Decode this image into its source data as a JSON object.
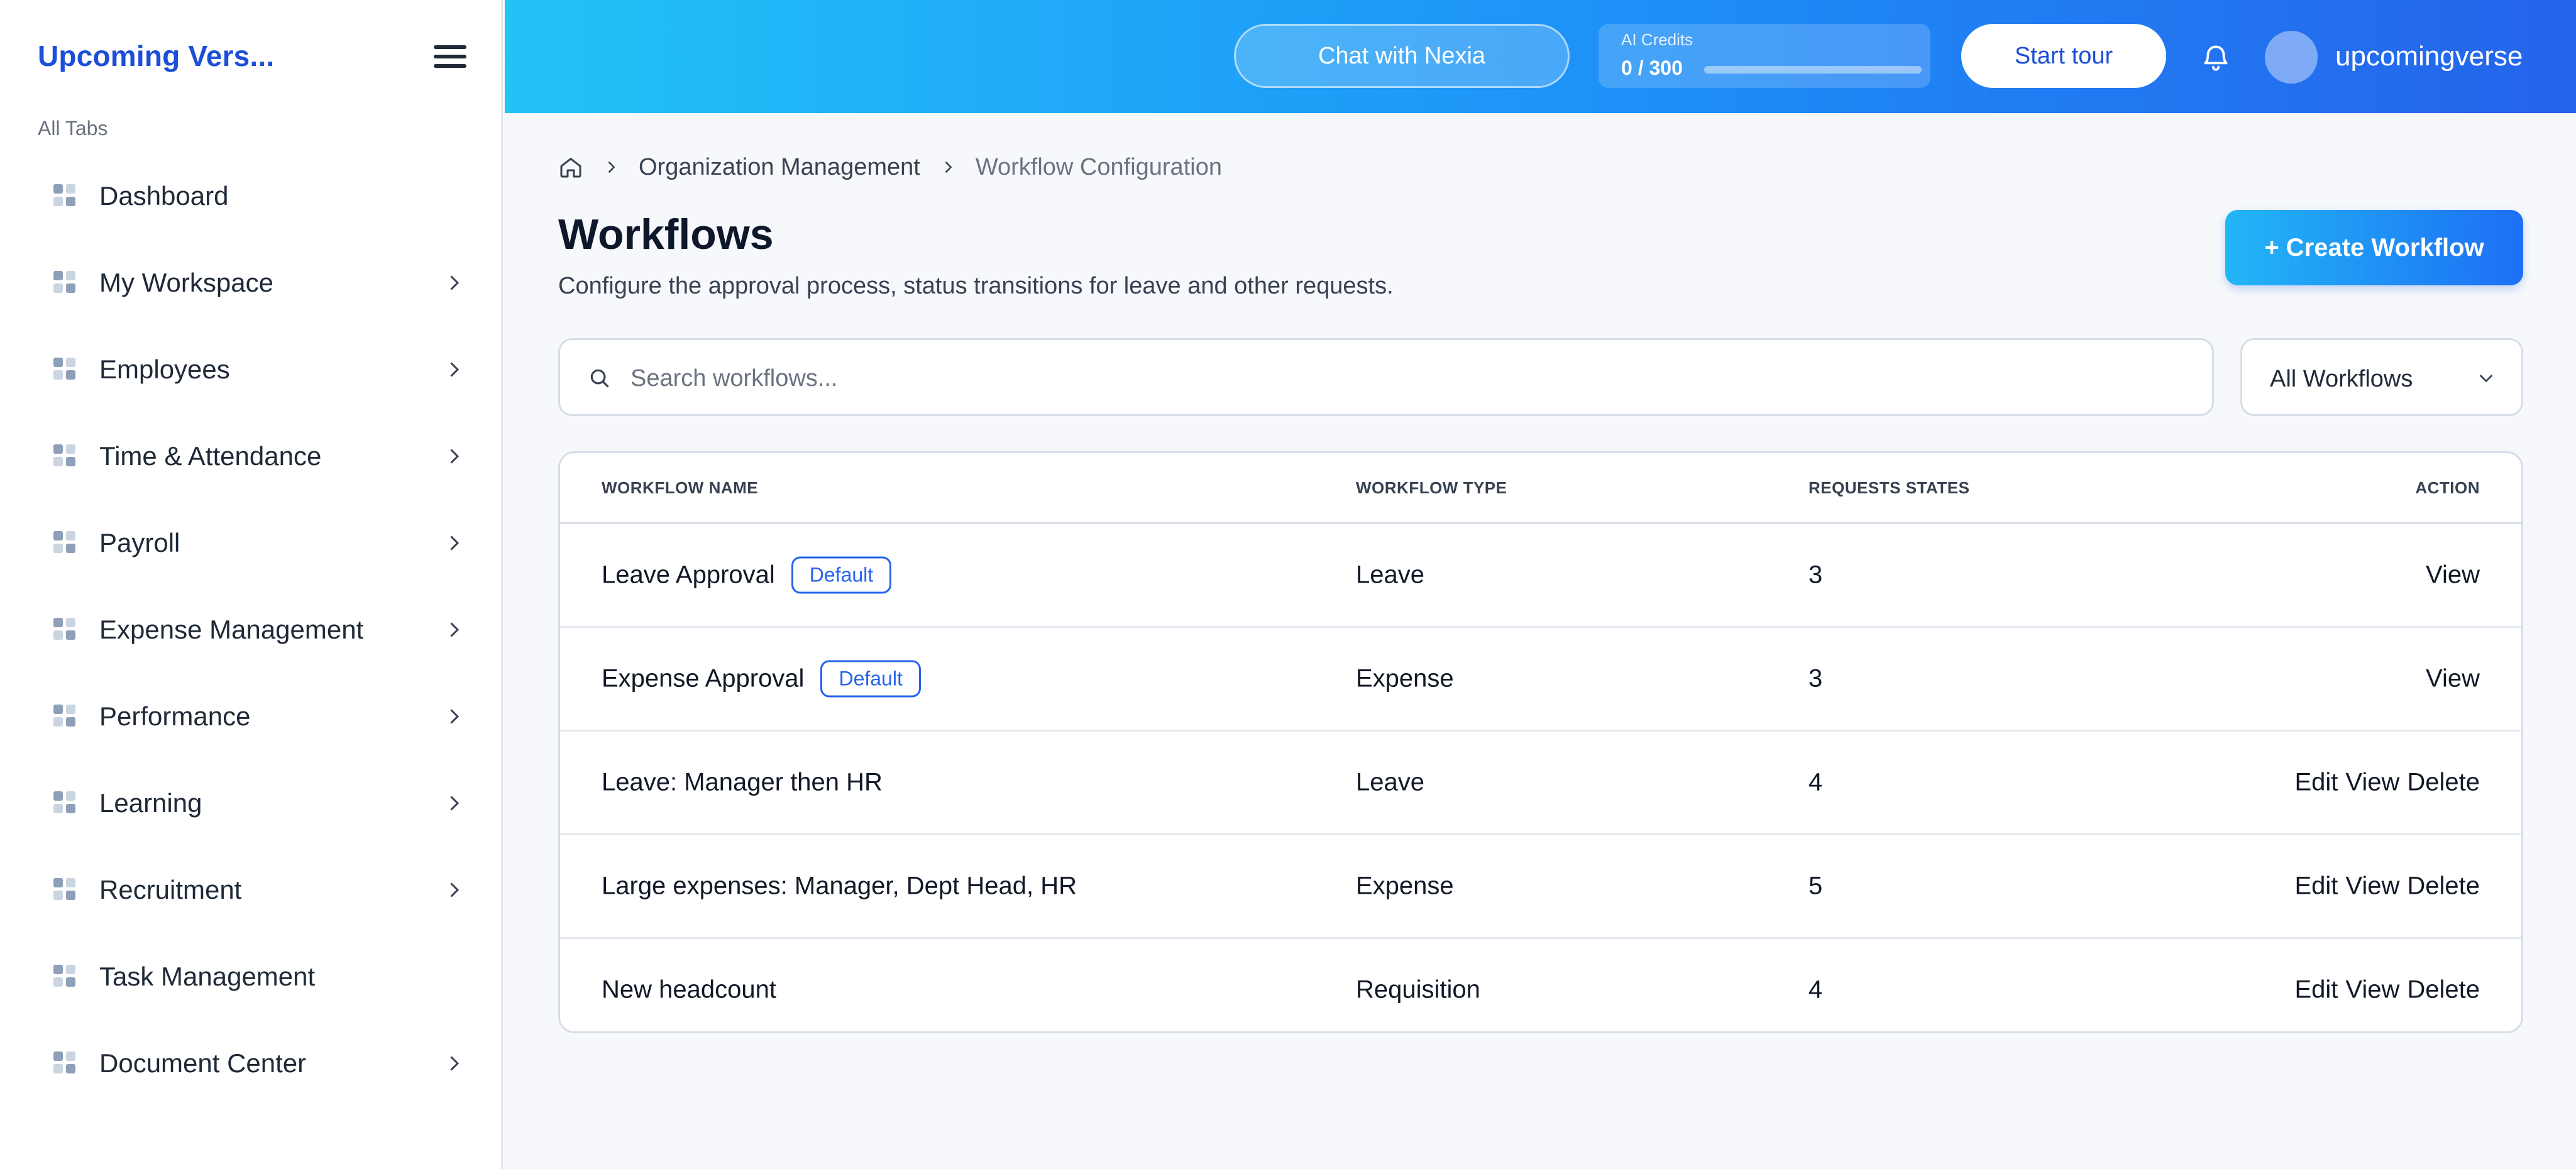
{
  "sidebar": {
    "brand": "Upcoming Vers...",
    "section_label": "All Tabs",
    "items": [
      {
        "label": "Dashboard",
        "has_chevron": false
      },
      {
        "label": "My Workspace",
        "has_chevron": true
      },
      {
        "label": "Employees",
        "has_chevron": true
      },
      {
        "label": "Time & Attendance",
        "has_chevron": true
      },
      {
        "label": "Payroll",
        "has_chevron": true
      },
      {
        "label": "Expense Management",
        "has_chevron": true
      },
      {
        "label": "Performance",
        "has_chevron": true
      },
      {
        "label": "Learning",
        "has_chevron": true
      },
      {
        "label": "Recruitment",
        "has_chevron": true
      },
      {
        "label": "Task Management",
        "has_chevron": false
      },
      {
        "label": "Document Center",
        "has_chevron": true
      }
    ]
  },
  "header": {
    "chat_label": "Chat with Nexia",
    "credits_label": "AI Credits",
    "credits_value": "0 / 300",
    "credits_progress": 0,
    "tour_label": "Start tour",
    "username": "upcomingverse"
  },
  "breadcrumb": {
    "items": [
      "Organization Management",
      "Workflow Configuration"
    ]
  },
  "page": {
    "title": "Workflows",
    "subtitle": "Configure the approval process, status transitions for leave and other requests.",
    "create_label": "+ Create Workflow"
  },
  "search": {
    "placeholder": "Search workflows...",
    "value": ""
  },
  "filter": {
    "selected": "All Workflows"
  },
  "table": {
    "columns": [
      "WORKFLOW NAME",
      "WORKFLOW TYPE",
      "REQUESTS STATES",
      "ACTION"
    ],
    "rows": [
      {
        "name": "Leave Approval",
        "badge": "Default",
        "type": "Leave",
        "states": "3",
        "actions": [
          "View"
        ]
      },
      {
        "name": "Expense Approval",
        "badge": "Default",
        "type": "Expense",
        "states": "3",
        "actions": [
          "View"
        ]
      },
      {
        "name": "Leave: Manager then HR",
        "badge": "",
        "type": "Leave",
        "states": "4",
        "actions": [
          "Edit",
          "View",
          "Delete"
        ]
      },
      {
        "name": "Large expenses: Manager, Dept Head, HR",
        "badge": "",
        "type": "Expense",
        "states": "5",
        "actions": [
          "Edit",
          "View",
          "Delete"
        ]
      },
      {
        "name": "New headcount",
        "badge": "",
        "type": "Requisition",
        "states": "4",
        "actions": [
          "Edit",
          "View",
          "Delete"
        ]
      }
    ]
  },
  "colors": {
    "brand": "#1d4ed8",
    "accent": "#2563eb",
    "header_gradient_start": "#22c3f7",
    "header_gradient_end": "#2563eb"
  },
  "icons": {
    "menu": "hamburger-icon",
    "nav": "grid-icon",
    "chevron": "chevron-right-icon",
    "bell": "bell-icon",
    "home": "home-icon",
    "search": "search-icon",
    "dropdown": "chevron-down-icon"
  }
}
